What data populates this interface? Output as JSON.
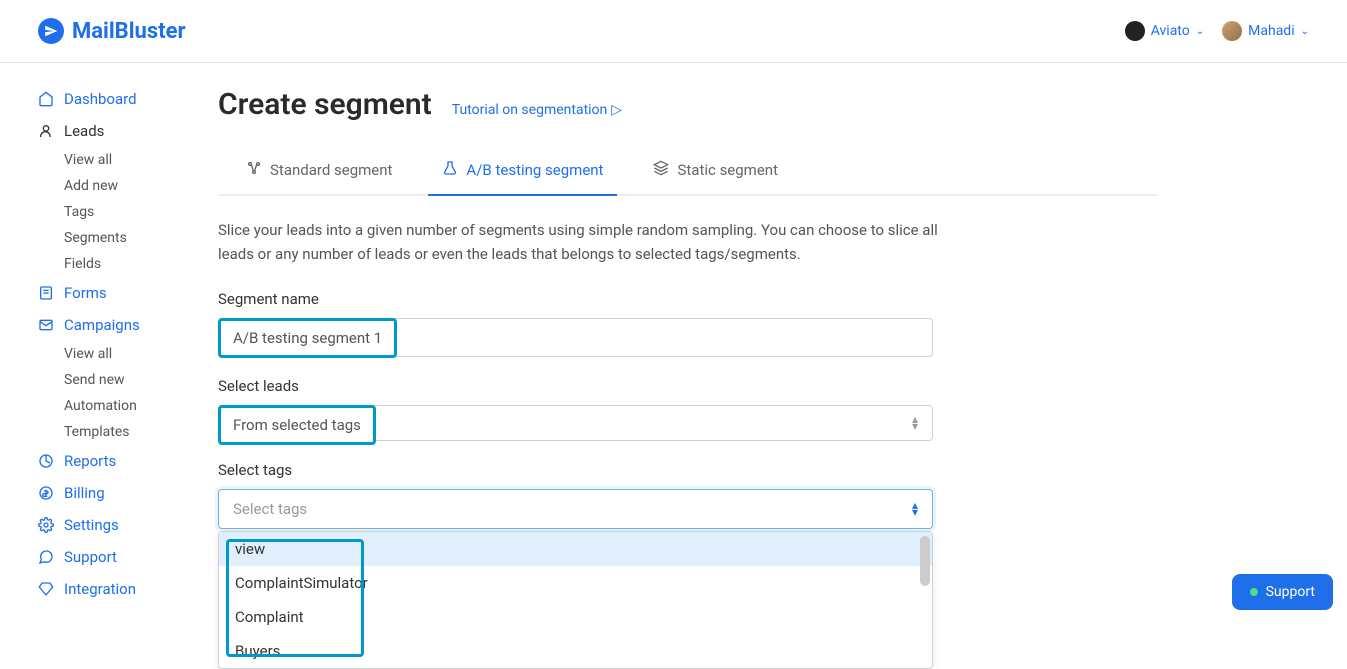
{
  "header": {
    "brand": "MailBluster",
    "org": "Aviato",
    "user": "Mahadi"
  },
  "sidebar": {
    "dashboard": "Dashboard",
    "leads": "Leads",
    "leads_sub": [
      "View all",
      "Add new",
      "Tags",
      "Segments",
      "Fields"
    ],
    "forms": "Forms",
    "campaigns": "Campaigns",
    "campaigns_sub": [
      "View all",
      "Send new",
      "Automation",
      "Templates"
    ],
    "reports": "Reports",
    "billing": "Billing",
    "settings": "Settings",
    "support": "Support",
    "integration": "Integration"
  },
  "page": {
    "title": "Create segment",
    "tutorial": "Tutorial on segmentation",
    "tabs": {
      "standard": "Standard segment",
      "ab": "A/B testing segment",
      "static": "Static segment"
    },
    "description": "Slice your leads into a given number of segments using simple random sampling. You can choose to slice all leads or any number of leads or even the leads that belongs to selected tags/segments.",
    "labels": {
      "segment_name": "Segment name",
      "select_leads": "Select leads",
      "select_tags": "Select tags"
    },
    "values": {
      "segment_name": "A/B testing segment 1",
      "select_leads": "From selected tags",
      "select_tags_placeholder": "Select tags"
    },
    "tag_options": [
      "view",
      "ComplaintSimulator",
      "Complaint",
      "Buyers"
    ]
  },
  "support_button": "Support"
}
